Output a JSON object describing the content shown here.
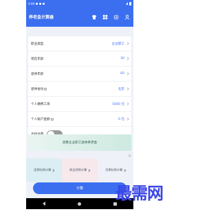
{
  "status_bar": {
    "time": "4:08"
  },
  "app_bar": {
    "title": "养老金计算器",
    "icons": [
      "shirt-icon",
      "grid-icon",
      "settings-icon",
      "user-icon"
    ]
  },
  "form": {
    "rows": [
      {
        "label": "职业类型",
        "value": "企业职工"
      },
      {
        "label": "现在年龄",
        "value": "30"
      },
      {
        "label": "退休年龄",
        "value": "60"
      },
      {
        "label": "退休省份",
        "value": "北京"
      },
      {
        "label": "个人缴费工资",
        "value": "5000 元"
      },
      {
        "label": "个人账户金额",
        "value": "0 元"
      },
      {
        "label": "高级设置"
      }
    ]
  },
  "banner": {
    "text": "测算企业职工退休养老金"
  },
  "ads": {
    "items": [
      "定期存款计算",
      "商业贷款计算",
      "活期存款计算"
    ],
    "close": "×"
  },
  "calc_button": {
    "label": "计算"
  },
  "watermark": {
    "text": "最需网"
  }
}
